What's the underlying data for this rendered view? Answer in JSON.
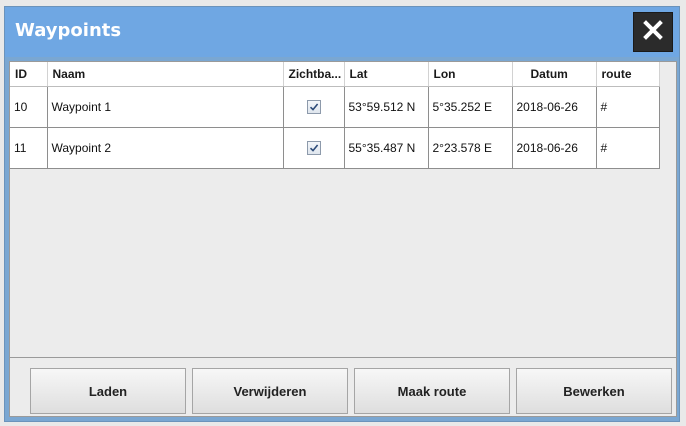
{
  "window": {
    "title": "Waypoints"
  },
  "table": {
    "columns": [
      "ID",
      "Naam",
      "Zichtba...",
      "Lat",
      "Lon",
      "Datum",
      "route"
    ],
    "rows": [
      {
        "id": "10",
        "naam": "Waypoint 1",
        "zichtbaar": true,
        "lat": "53°59.512 N",
        "lon": "5°35.252 E",
        "datum": "2018-06-26",
        "route": "#"
      },
      {
        "id": "11",
        "naam": "Waypoint 2",
        "zichtbaar": true,
        "lat": "55°35.487 N",
        "lon": "2°23.578 E",
        "datum": "2018-06-26",
        "route": "#"
      }
    ]
  },
  "buttons": {
    "laden": "Laden",
    "verwijderen": "Verwijderen",
    "maak_route": "Maak route",
    "bewerken": "Bewerken"
  }
}
